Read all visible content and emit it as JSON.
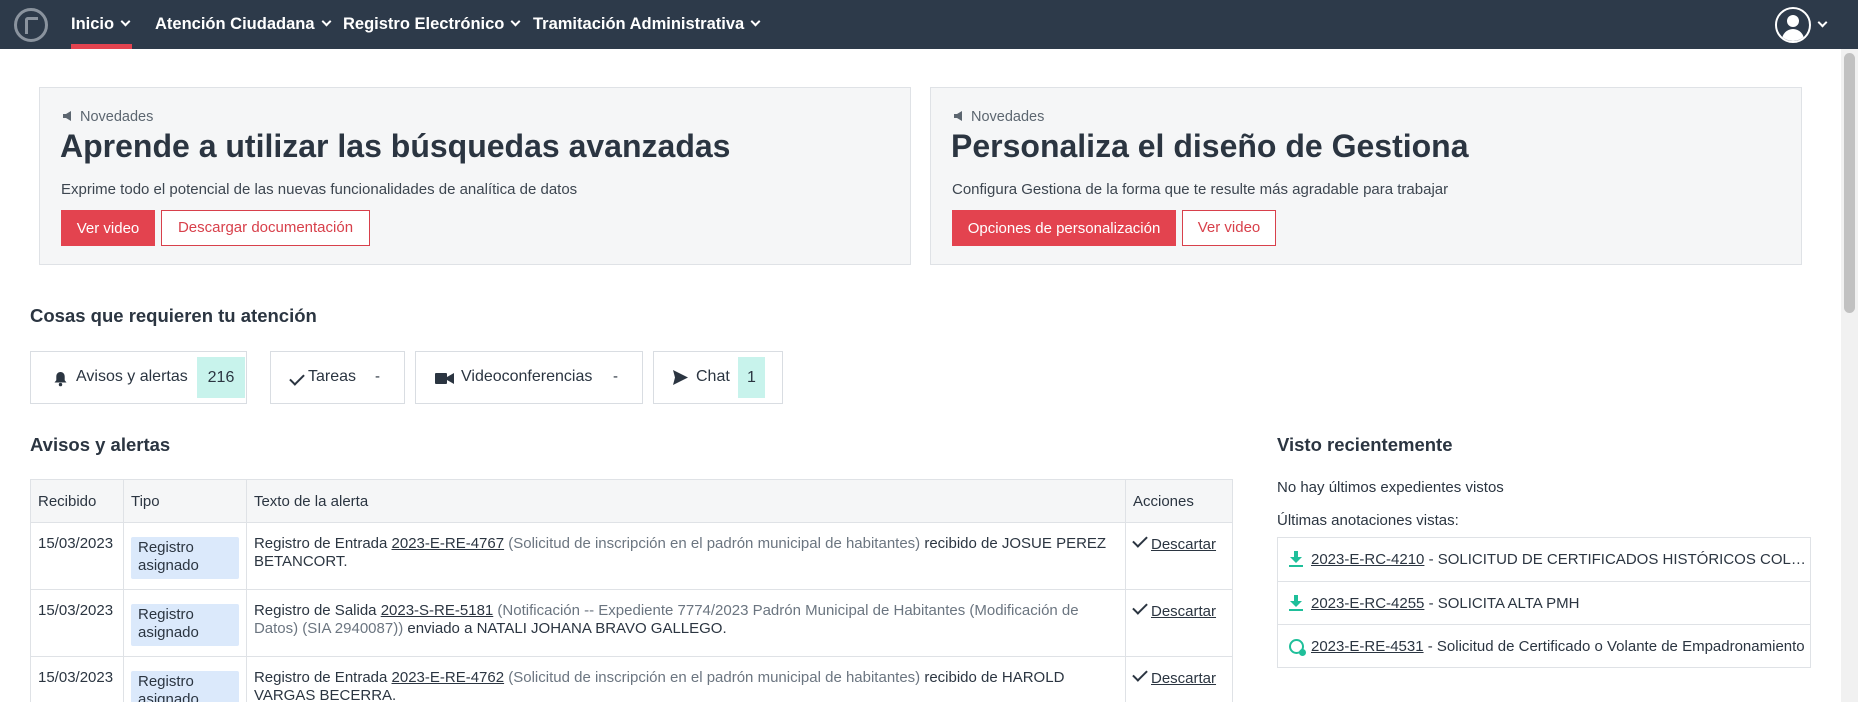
{
  "nav": {
    "items": [
      {
        "label": "Inicio"
      },
      {
        "label": "Atención Ciudadana"
      },
      {
        "label": "Registro Electrónico"
      },
      {
        "label": "Tramitación Administrativa"
      }
    ]
  },
  "promos": [
    {
      "kicker": "Novedades",
      "title": "Aprende a utilizar las búsquedas avanzadas",
      "subtitle": "Exprime todo el potencial de las nuevas funcionalidades de analítica de datos",
      "primary": "Ver video",
      "secondary": "Descargar documentación"
    },
    {
      "kicker": "Novedades",
      "title": "Personaliza el diseño de Gestiona",
      "subtitle": "Configura Gestiona de la forma que te resulte más agradable para trabajar",
      "primary": "Opciones de personalización",
      "secondary": "Ver video"
    }
  ],
  "attention": {
    "title": "Cosas que requieren tu atención",
    "boxes": [
      {
        "label": "Avisos y alertas",
        "count": "216"
      },
      {
        "label": "Tareas",
        "count": "-"
      },
      {
        "label": "Videoconferencias",
        "count": "-"
      },
      {
        "label": "Chat",
        "count": "1"
      }
    ]
  },
  "alerts": {
    "title": "Avisos y alertas",
    "columns": [
      "Recibido",
      "Tipo",
      "Texto de la alerta",
      "Acciones"
    ],
    "action_label": "Descartar",
    "rows": [
      {
        "date": "15/03/2023",
        "type": "Registro asignado",
        "prefix": "Registro de Entrada ",
        "code": "2023-E-RE-4767",
        "detail": " (Solicitud de inscripción en el padrón municipal de habitantes)",
        "suffix": " recibido de JOSUE PEREZ BETANCORT."
      },
      {
        "date": "15/03/2023",
        "type": "Registro asignado",
        "prefix": "Registro de Salida ",
        "code": "2023-S-RE-5181",
        "detail": " (Notificación -- Expediente 7774/2023 Padrón Municipal de Habitantes (Modificación de Datos) (SIA 2940087))",
        "suffix": " enviado a NATALI JOHANA BRAVO GALLEGO."
      },
      {
        "date": "15/03/2023",
        "type": "Registro asignado",
        "prefix": "Registro de Entrada ",
        "code": "2023-E-RE-4762",
        "detail": " (Solicitud de inscripción en el padrón municipal de habitantes)",
        "suffix": " recibido de HAROLD VARGAS BECERRA."
      }
    ]
  },
  "recent": {
    "title": "Visto recientemente",
    "no_files": "No hay últimos expedientes vistos",
    "annotations_label": "Últimas anotaciones vistas:",
    "items": [
      {
        "code": "2023-E-RC-4210",
        "text": " - SOLICITUD DE CERTIFICADOS HISTÓRICOS COLECTIVOS",
        "icon": "download-icon"
      },
      {
        "code": "2023-E-RC-4255",
        "text": " - SOLICITA ALTA PMH",
        "icon": "download-icon"
      },
      {
        "code": "2023-E-RE-4531",
        "text": " - Solicitud de Certificado o Volante de Empadronamiento",
        "icon": "online-icon"
      }
    ]
  },
  "colors": {
    "navbar": "#2d3a4a",
    "accent": "#e3434f",
    "badge_bg": "#dbe9fb",
    "count_bg": "#c8f3ec",
    "icon_green": "#1fbf9a"
  }
}
